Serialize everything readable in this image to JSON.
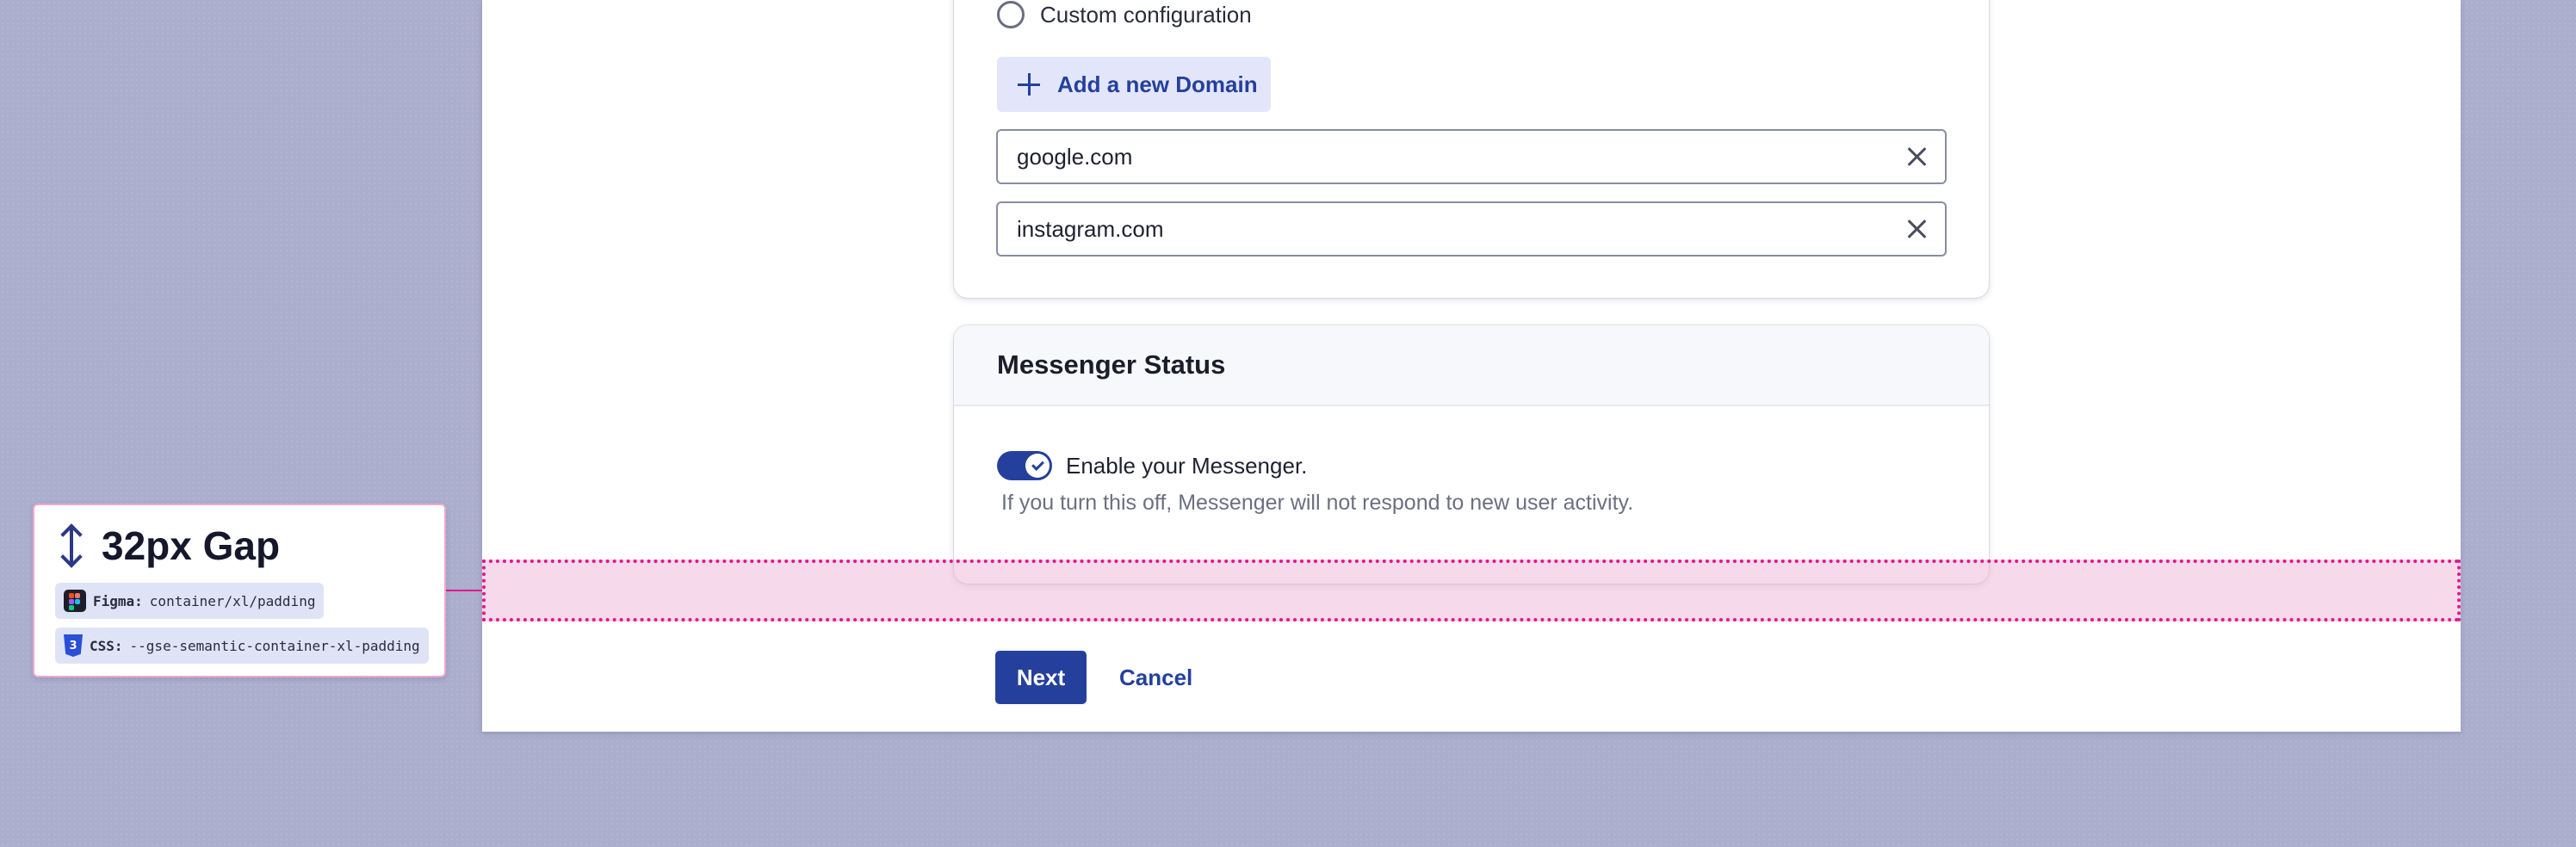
{
  "domain_card": {
    "radio_label": "Custom configuration",
    "add_domain_label": "Add a new Domain",
    "domains": [
      "google.com",
      "instagram.com"
    ]
  },
  "messenger_card": {
    "title": "Messenger Status",
    "toggle_label": "Enable your Messenger.",
    "toggle_on": true,
    "helper_text": "If you turn this off, Messenger will not respond to new user activity."
  },
  "annotation": {
    "heading": "32px Gap",
    "figma_key": "Figma:",
    "figma_value": "container/xl/padding",
    "css_key": "CSS:",
    "css_value": "--gse-semantic-container-xl-padding"
  },
  "actions": {
    "next_label": "Next",
    "cancel_label": "Cancel"
  },
  "colors": {
    "primary": "#25409c",
    "highlight": "#e3168c",
    "background": "#abaecd"
  }
}
